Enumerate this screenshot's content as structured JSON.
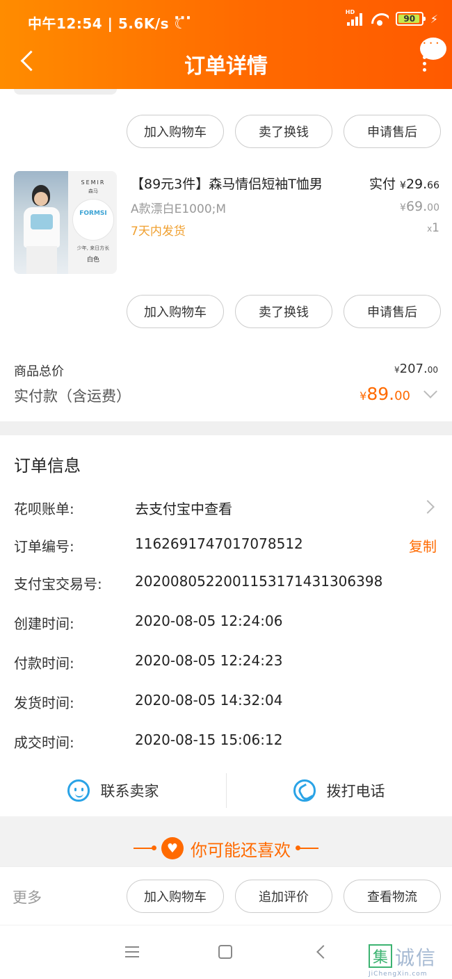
{
  "status_bar": {
    "time_speed": "中午12:54 | 5.6K/s ☾",
    "dots": "···",
    "hd": "HD",
    "battery": "90"
  },
  "header": {
    "title": "订单详情"
  },
  "actions_row_1": [
    "加入购物车",
    "卖了换钱",
    "申请售后"
  ],
  "product": {
    "title": "【89元3件】森马情侣短袖T恤男",
    "sku": "A款漂白E1000;M",
    "shipping": "7天内发货",
    "paid_label": "实付",
    "paid_currency": "¥",
    "paid_int": "29.",
    "paid_dec": "66",
    "orig_currency": "¥",
    "orig_int": "69.",
    "orig_dec": "00",
    "qty_x": "x",
    "qty": "1",
    "image_brand": "SEMIR",
    "image_brand_cn": "森马",
    "image_print": "FORMSI",
    "image_caption": "少年, 来日方长",
    "image_color": "白色"
  },
  "actions_row_2": [
    "加入购物车",
    "卖了换钱",
    "申请售后"
  ],
  "totals": {
    "goods_total_label": "商品总价",
    "goods_total_currency": "¥",
    "goods_total_int": "207.",
    "goods_total_dec": "00",
    "paid_label": "实付款（含运费）",
    "paid_currency": "¥",
    "paid_int": "89.",
    "paid_dec": "00"
  },
  "order_info": {
    "title": "订单信息",
    "rows": [
      {
        "key": "花呗账单:",
        "value": "去支付宝中查看"
      },
      {
        "key": "订单编号:",
        "value": "1162691747017078512",
        "action": "复制"
      },
      {
        "key": "支付宝交易号:",
        "value": "2020080522001153171431306398"
      },
      {
        "key": "创建时间:",
        "value": "2020-08-05 12:24:06"
      },
      {
        "key": "付款时间:",
        "value": "2020-08-05 12:24:23"
      },
      {
        "key": "发货时间:",
        "value": "2020-08-05 14:32:04"
      },
      {
        "key": "成交时间:",
        "value": "2020-08-15 15:06:12"
      }
    ]
  },
  "contact": {
    "seller": "联系卖家",
    "phone": "拨打电话"
  },
  "recommend": {
    "title": "你可能还喜欢",
    "heart": "♥"
  },
  "bottom_bar": {
    "more": "更多",
    "buttons": [
      "加入购物车",
      "追加评价",
      "查看物流"
    ]
  },
  "watermark": {
    "box": "集",
    "text": "诚信",
    "url": "JiChengXin.com"
  },
  "colors": {
    "accent": "#ff6a00",
    "link_blue": "#2aa3e6"
  }
}
